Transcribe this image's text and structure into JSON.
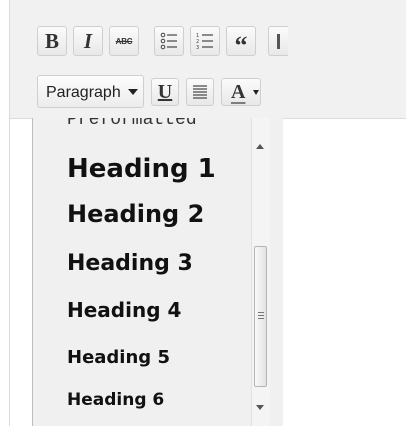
{
  "toolbar": {
    "row1": [
      {
        "name": "bold-button",
        "glyph": "B"
      },
      {
        "name": "italic-button",
        "glyph": "I"
      },
      {
        "name": "strikethrough-button",
        "glyph": "ABC"
      },
      {
        "name": "bulleted-list-button",
        "icon": "bullet-list-icon"
      },
      {
        "name": "numbered-list-button",
        "icon": "numbered-list-icon"
      },
      {
        "name": "blockquote-button",
        "glyph": "“"
      },
      {
        "name": "align-button",
        "icon": "align-icon"
      }
    ],
    "row2": {
      "format_select": {
        "value": "Paragraph"
      },
      "underline_glyph": "U",
      "justify_icon": "justify-icon",
      "text_color_glyph": "A",
      "text_color_bar": "#7d7d7d"
    }
  },
  "format_menu": {
    "items": [
      {
        "label": "Preformatted",
        "style": "pre"
      },
      {
        "label": "Heading 1",
        "style": "h1"
      },
      {
        "label": "Heading 2",
        "style": "h2"
      },
      {
        "label": "Heading 3",
        "style": "h3"
      },
      {
        "label": "Heading 4",
        "style": "h4"
      },
      {
        "label": "Heading 5",
        "style": "h5"
      },
      {
        "label": "Heading 6",
        "style": "h6"
      }
    ]
  },
  "colors": {
    "toolbar_bg": "#f1f1f1",
    "menu_bg": "#f0f0f0",
    "button_border": "#cfcfcf"
  }
}
